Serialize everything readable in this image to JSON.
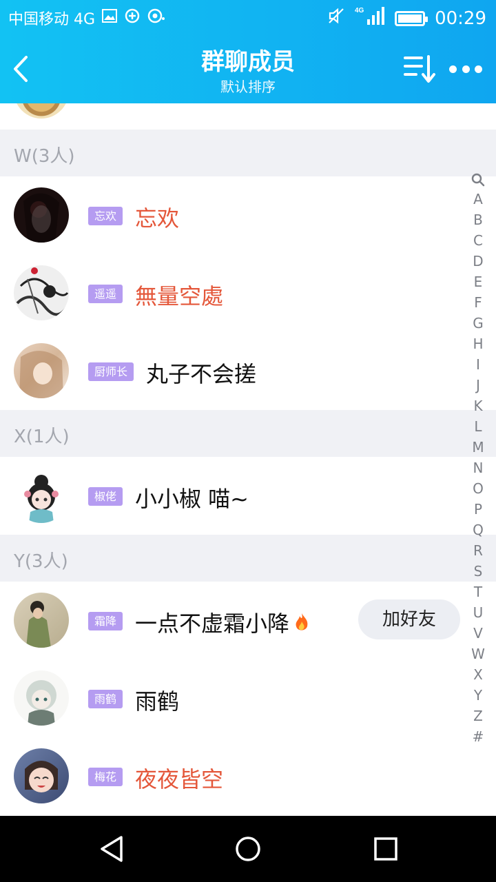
{
  "status_bar": {
    "carrier": "中国移动 4G",
    "network": "4G",
    "time": "00:29"
  },
  "header": {
    "title": "群聊成员",
    "subtitle": "默认排序"
  },
  "sections": [
    {
      "title": "W(3人)",
      "members": [
        {
          "badge": "忘欢",
          "name": "忘欢",
          "name_color": "red"
        },
        {
          "badge": "遥遥",
          "name": "無量空處",
          "name_color": "red"
        },
        {
          "badge": "厨师长",
          "name": "丸子不会搓",
          "name_color": "black"
        }
      ]
    },
    {
      "title": "X(1人)",
      "members": [
        {
          "badge": "椒佬",
          "name": "小小椒 喵~",
          "name_color": "black"
        }
      ]
    },
    {
      "title": "Y(3人)",
      "members": [
        {
          "badge": "霜降",
          "name": "一点不虚霜小降",
          "name_color": "black",
          "action": "加好友"
        },
        {
          "badge": "雨鹤",
          "name": "雨鹤",
          "name_color": "black"
        },
        {
          "badge": "梅花",
          "name": "夜夜皆空",
          "name_color": "red"
        }
      ]
    }
  ],
  "index_bar": [
    "A",
    "B",
    "C",
    "D",
    "E",
    "F",
    "G",
    "H",
    "I",
    "J",
    "K",
    "L",
    "M",
    "N",
    "O",
    "P",
    "Q",
    "R",
    "S",
    "T",
    "U",
    "V",
    "W",
    "X",
    "Y",
    "Z",
    "#"
  ],
  "colors": {
    "header_gradient_start": "#12c2f3",
    "header_gradient_end": "#0fa6f0",
    "badge": "#b59cf1",
    "name_red": "#e4573a",
    "section_bg": "#f0f1f5"
  }
}
